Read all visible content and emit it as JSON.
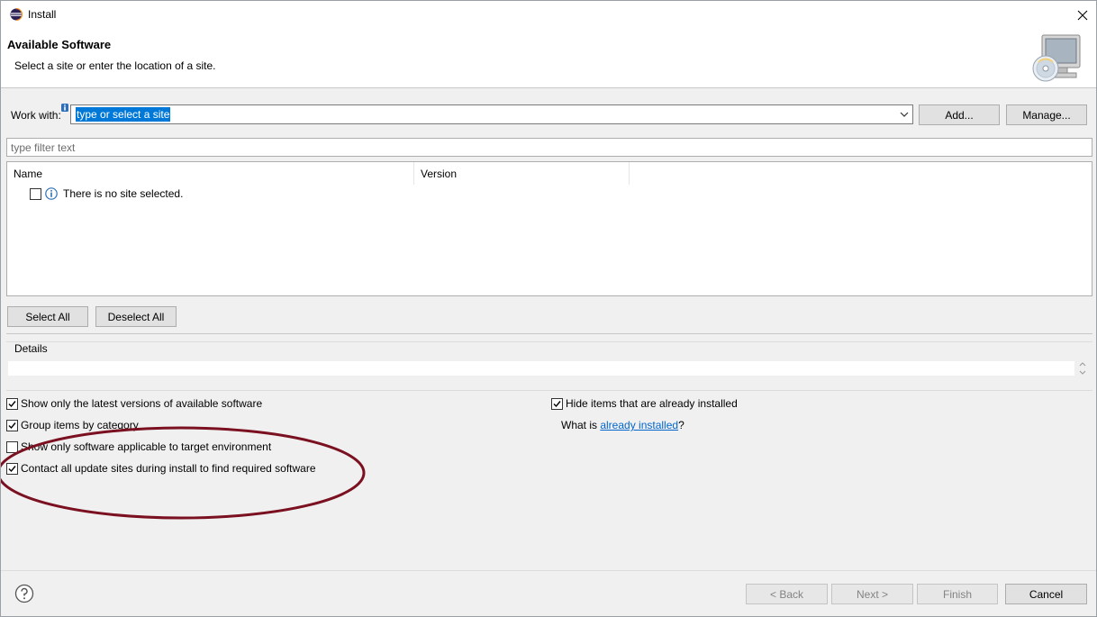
{
  "window": {
    "title": "Install",
    "icon": "eclipse-icon",
    "close_icon": "close-icon"
  },
  "header": {
    "title": "Available Software",
    "subtitle": "Select a site or enter the location of a site.",
    "banner_icon": "install-software-monitor-cd-icon"
  },
  "work_with": {
    "label": "Work with:",
    "value": "type or select a site",
    "info_icon": "info-marker-icon",
    "add_button": "Add...",
    "manage_button": "Manage..."
  },
  "filter": {
    "placeholder": "type filter text"
  },
  "tree": {
    "columns": [
      "Name",
      "Version"
    ],
    "rows": [
      {
        "checked": false,
        "icon": "info-icon",
        "name": "There is no site selected.",
        "version": ""
      }
    ]
  },
  "selection_buttons": {
    "select_all": "Select All",
    "deselect_all": "Deselect All"
  },
  "details": {
    "label": "Details"
  },
  "options": {
    "left": [
      {
        "label": "Show only the latest versions of available software",
        "checked": true
      },
      {
        "label": "Group items by category",
        "checked": true
      },
      {
        "label": "Show only software applicable to target environment",
        "checked": false
      },
      {
        "label": "Contact all update sites during install to find required software",
        "checked": true
      }
    ],
    "right": {
      "hide_installed": {
        "label": "Hide items that are already installed",
        "checked": true
      },
      "what_is_prefix": "What is ",
      "what_is_link": "already installed",
      "what_is_suffix": "?"
    }
  },
  "annotation": {
    "color": "#7a1020"
  },
  "footer": {
    "help_icon": "help-question-icon",
    "back": "< Back",
    "next": "Next >",
    "finish": "Finish",
    "cancel": "Cancel"
  },
  "colors": {
    "selection": "#0078d7",
    "link": "#0066cc",
    "dialog_bg": "#f0f0f0"
  }
}
